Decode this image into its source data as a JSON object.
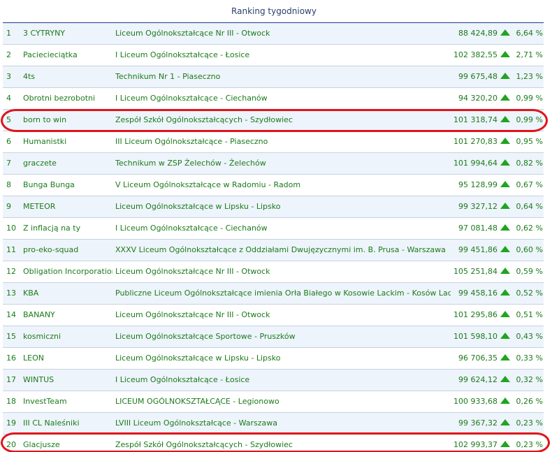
{
  "title": "Ranking tygodniowy",
  "colors": {
    "text_green": "#1b7a1b",
    "title_blue": "#2c3e6e",
    "arrow_green": "#1fa51f",
    "stripe": "#eef4fb",
    "highlight_red": "#e0141a"
  },
  "rows": [
    {
      "rank": "1",
      "team": "3 CYTRYNY",
      "school": "Liceum Ogólnokształcące Nr III - Otwock",
      "value": "88 424,89",
      "trend_icon": "arrow-up-icon",
      "pct": "6,64 %"
    },
    {
      "rank": "2",
      "team": "Paciecieciątka",
      "school": "I Liceum Ogólnokształcące - Łosice",
      "value": "102 382,55",
      "trend_icon": "arrow-up-icon",
      "pct": "2,71 %"
    },
    {
      "rank": "3",
      "team": "4ts",
      "school": "Technikum Nr 1 - Piaseczno",
      "value": "99 675,48",
      "trend_icon": "arrow-up-icon",
      "pct": "1,23 %"
    },
    {
      "rank": "4",
      "team": "Obrotni bezrobotni",
      "school": "I Liceum Ogólnokształcące - Ciechanów",
      "value": "94 320,20",
      "trend_icon": "arrow-up-icon",
      "pct": "0,99 %"
    },
    {
      "rank": "5",
      "team": "born to win",
      "school": "Zespół Szkół Ogólnokształcących - Szydłowiec",
      "value": "101 318,74",
      "trend_icon": "arrow-up-icon",
      "pct": "0,99 %"
    },
    {
      "rank": "6",
      "team": "Humanistki",
      "school": "III Liceum Ogólnokształcące - Piaseczno",
      "value": "101 270,83",
      "trend_icon": "arrow-up-icon",
      "pct": "0,95 %"
    },
    {
      "rank": "7",
      "team": "graczete",
      "school": "Technikum w ZSP Żelechów - Żelechów",
      "value": "101 994,64",
      "trend_icon": "arrow-up-icon",
      "pct": "0,82 %"
    },
    {
      "rank": "8",
      "team": "Bunga Bunga",
      "school": "V Liceum Ogólnokształcące w Radomiu - Radom",
      "value": "95 128,99",
      "trend_icon": "arrow-up-icon",
      "pct": "0,67 %"
    },
    {
      "rank": "9",
      "team": "METEOR",
      "school": "Liceum Ogólnokształcące w Lipsku - Lipsko",
      "value": "99 327,12",
      "trend_icon": "arrow-up-icon",
      "pct": "0,64 %"
    },
    {
      "rank": "10",
      "team": "Z inflacją na ty",
      "school": "I Liceum Ogólnokształcące - Ciechanów",
      "value": "97 081,48",
      "trend_icon": "arrow-up-icon",
      "pct": "0,62 %"
    },
    {
      "rank": "11",
      "team": "pro-eko-squad",
      "school": "XXXV Liceum Ogólnokształcące z Oddziałami Dwujęzycznymi im. B. Prusa - Warszawa",
      "value": "99 451,86",
      "trend_icon": "arrow-up-icon",
      "pct": "0,60 %"
    },
    {
      "rank": "12",
      "team": "Obligation Incorporation",
      "school": "Liceum Ogólnokształcące Nr III - Otwock",
      "value": "105 251,84",
      "trend_icon": "arrow-up-icon",
      "pct": "0,59 %"
    },
    {
      "rank": "13",
      "team": "KBA",
      "school": "Publiczne Liceum Ogólnokształcące imienia Orła Białego w Kosowie Lackim - Kosów Lacki",
      "value": "99 458,16",
      "trend_icon": "arrow-up-icon",
      "pct": "0,52 %"
    },
    {
      "rank": "14",
      "team": "BANANY",
      "school": "Liceum Ogólnokształcące Nr III - Otwock",
      "value": "101 295,86",
      "trend_icon": "arrow-up-icon",
      "pct": "0,51 %"
    },
    {
      "rank": "15",
      "team": "kosmiczni",
      "school": "Liceum Ogólnokształcące Sportowe - Pruszków",
      "value": "101 598,10",
      "trend_icon": "arrow-up-icon",
      "pct": "0,43 %"
    },
    {
      "rank": "16",
      "team": "LEON",
      "school": "Liceum Ogólnokształcące w Lipsku - Lipsko",
      "value": "96 706,35",
      "trend_icon": "arrow-up-icon",
      "pct": "0,33 %"
    },
    {
      "rank": "17",
      "team": "WINTUS",
      "school": "I Liceum Ogólnokształcące - Łosice",
      "value": "99 624,12",
      "trend_icon": "arrow-up-icon",
      "pct": "0,32 %"
    },
    {
      "rank": "18",
      "team": "InvestTeam",
      "school": "LICEUM OGÓLNOKSZTAŁCĄCE - Legionowo",
      "value": "100 933,68",
      "trend_icon": "arrow-up-icon",
      "pct": "0,26 %"
    },
    {
      "rank": "19",
      "team": "III CL Naleśniki",
      "school": "LVIII Liceum Ogólnokształcące - Warszawa",
      "value": "99 367,32",
      "trend_icon": "arrow-up-icon",
      "pct": "0,23 %"
    },
    {
      "rank": "20",
      "team": "Glacjusze",
      "school": "Zespół Szkół Ogólnokształcących - Szydłowiec",
      "value": "102 993,37",
      "trend_icon": "arrow-up-icon",
      "pct": "0,23 %"
    }
  ]
}
